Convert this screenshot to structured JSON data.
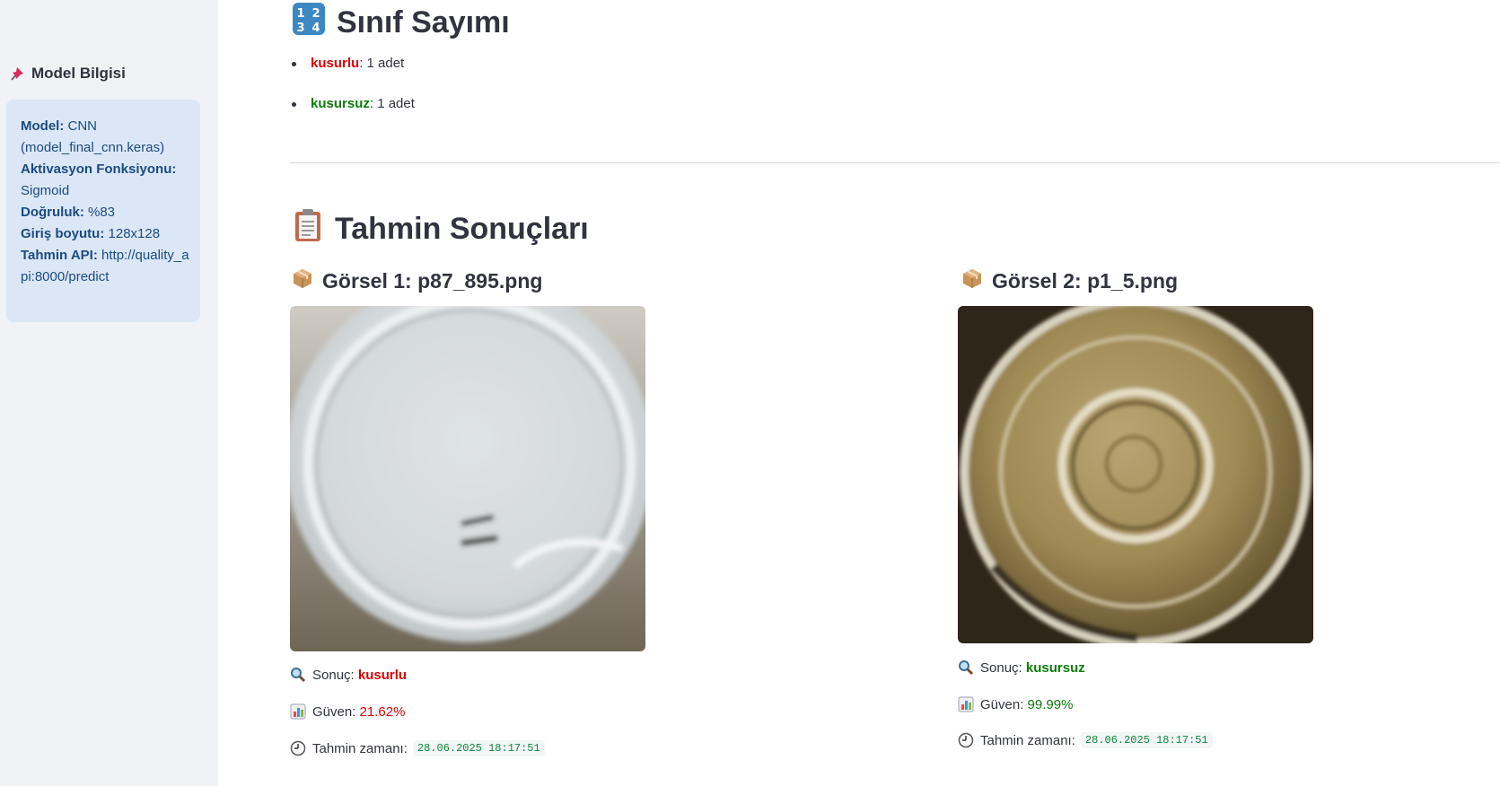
{
  "sidebar": {
    "title": "Model Bilgisi",
    "model_label": "Model:",
    "model_value": "CNN (model_final_cnn.keras)",
    "activation_label": "Aktivasyon Fonksiyonu:",
    "activation_value": "Sigmoid",
    "accuracy_label": "Doğruluk:",
    "accuracy_value": "%83",
    "input_label": "Giriş boyutu:",
    "input_value": "128x128",
    "api_label": "Tahmin API:",
    "api_value": "http://quality_api:8000/predict"
  },
  "counts": {
    "title": "Sınıf Sayımı",
    "items": [
      {
        "label": "kusurlu",
        "suffix": ": 1 adet",
        "color": "#e00000"
      },
      {
        "label": "kusursuz",
        "suffix": ": 1 adet",
        "color": "#0a7d0a"
      }
    ]
  },
  "results": {
    "title": "Tahmin Sonuçları",
    "cards": [
      {
        "title": "Görsel 1: p87_895.png",
        "result_label": "Sonuç:",
        "result_value": "kusurlu",
        "confidence_label": "Güven:",
        "confidence_value": "21.62%",
        "time_label": "Tahmin zamanı:",
        "time_value": "28.06.2025 18:17:51"
      },
      {
        "title": "Görsel 2: p1_5.png",
        "result_label": "Sonuç:",
        "result_value": "kusursuz",
        "confidence_label": "Güven:",
        "confidence_value": "99.99%",
        "time_label": "Tahmin zamanı:",
        "time_value": "28.06.2025 18:17:51"
      }
    ]
  },
  "colors": {
    "defect": "#e00000",
    "ok": "#0a7d0a",
    "info_bg": "#dbe7f6",
    "info_text": "#1c4b81"
  }
}
